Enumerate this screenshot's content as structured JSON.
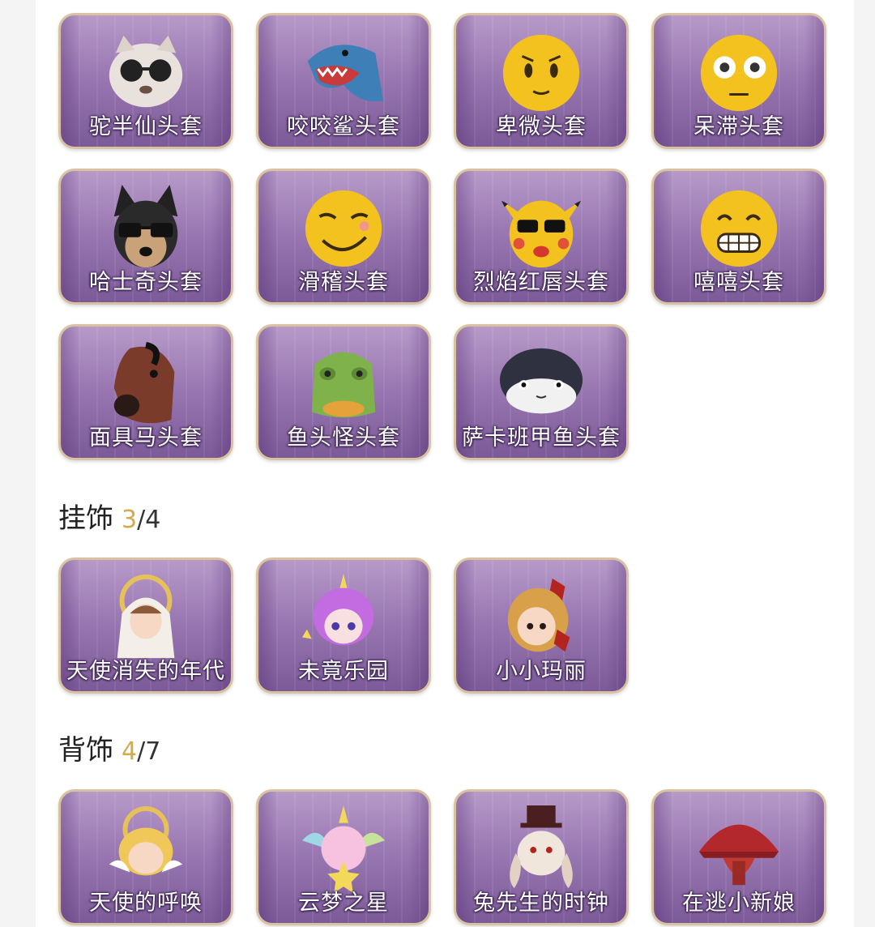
{
  "headgear": {
    "items": [
      {
        "label": "驼半仙头套",
        "icon": "raccoon-sunglasses-mask-icon"
      },
      {
        "label": "咬咬鲨头套",
        "icon": "shark-mask-icon"
      },
      {
        "label": "卑微头套",
        "icon": "humble-emoji-mask-icon"
      },
      {
        "label": "呆滞头套",
        "icon": "dazed-emoji-mask-icon"
      },
      {
        "label": "哈士奇头套",
        "icon": "husky-sunglasses-mask-icon"
      },
      {
        "label": "滑稽头套",
        "icon": "funny-emoji-mask-icon"
      },
      {
        "label": "烈焰红唇头套",
        "icon": "yellow-creature-sunglasses-mask-icon"
      },
      {
        "label": "嘻嘻头套",
        "icon": "grin-emoji-mask-icon"
      },
      {
        "label": "面具马头套",
        "icon": "horse-mask-icon"
      },
      {
        "label": "鱼头怪头套",
        "icon": "fish-head-mask-icon"
      },
      {
        "label": "萨卡班甲鱼头套",
        "icon": "sacabambaspis-mask-icon"
      }
    ]
  },
  "pendants": {
    "title": "挂饰",
    "owned": "3",
    "total": "/4",
    "items": [
      {
        "label": "天使消失的年代",
        "icon": "angel-girl-pendant-icon"
      },
      {
        "label": "未竟乐园",
        "icon": "unicorn-girl-pendant-icon"
      },
      {
        "label": "小小玛丽",
        "icon": "little-mary-pendant-icon"
      }
    ]
  },
  "back": {
    "title": "背饰",
    "owned": "4",
    "total": "/7",
    "items": [
      {
        "label": "天使的呼唤",
        "icon": "angel-child-backpiece-icon"
      },
      {
        "label": "云梦之星",
        "icon": "unicorn-star-backpiece-icon"
      },
      {
        "label": "兔先生的时钟",
        "icon": "rabbit-clock-backpiece-icon"
      },
      {
        "label": "在逃小新娘",
        "icon": "bride-mushroom-backpiece-icon"
      }
    ]
  },
  "colors": {
    "accent": "#d6a94a",
    "card_border": "#d9c2a0",
    "card_purple": "#9a78b2"
  }
}
